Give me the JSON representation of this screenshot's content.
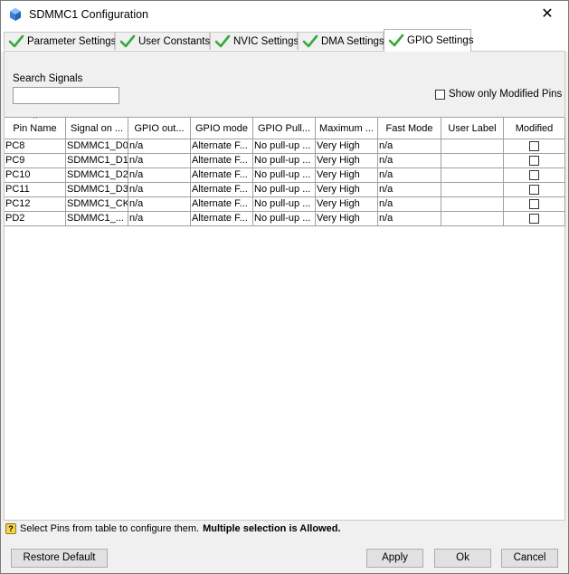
{
  "window": {
    "title": "SDMMC1 Configuration",
    "close_glyph": "✕",
    "icon": "cube-icon"
  },
  "tabs": [
    {
      "label": "Parameter Settings",
      "icon": "check-icon",
      "active": false
    },
    {
      "label": "User Constants",
      "icon": "check-icon",
      "active": false
    },
    {
      "label": "NVIC Settings",
      "icon": "check-icon",
      "active": false
    },
    {
      "label": "DMA Settings",
      "icon": "check-icon",
      "active": false
    },
    {
      "label": "GPIO Settings",
      "icon": "check-icon",
      "active": true
    }
  ],
  "search": {
    "label": "Search Signals",
    "value": "",
    "placeholder": ""
  },
  "show_modified": {
    "label": "Show only Modified Pins",
    "checked": false
  },
  "table": {
    "columns": [
      "Pin Name",
      "Signal on ...",
      "GPIO out...",
      "GPIO mode",
      "GPIO Pull...",
      "Maximum ...",
      "Fast Mode",
      "User Label",
      "Modified"
    ],
    "sort_indicator": "^",
    "rows": [
      {
        "pin": "PC8",
        "signal": "SDMMC1_D0",
        "out": "n/a",
        "mode": "Alternate F...",
        "pull": "No pull-up ...",
        "max": "Very High",
        "fast": "n/a",
        "user": "",
        "modified": false
      },
      {
        "pin": "PC9",
        "signal": "SDMMC1_D1",
        "out": "n/a",
        "mode": "Alternate F...",
        "pull": "No pull-up ...",
        "max": "Very High",
        "fast": "n/a",
        "user": "",
        "modified": false
      },
      {
        "pin": "PC10",
        "signal": "SDMMC1_D2",
        "out": "n/a",
        "mode": "Alternate F...",
        "pull": "No pull-up ...",
        "max": "Very High",
        "fast": "n/a",
        "user": "",
        "modified": false
      },
      {
        "pin": "PC11",
        "signal": "SDMMC1_D3",
        "out": "n/a",
        "mode": "Alternate F...",
        "pull": "No pull-up ...",
        "max": "Very High",
        "fast": "n/a",
        "user": "",
        "modified": false
      },
      {
        "pin": "PC12",
        "signal": "SDMMC1_CK",
        "out": "n/a",
        "mode": "Alternate F...",
        "pull": "No pull-up ...",
        "max": "Very High",
        "fast": "n/a",
        "user": "",
        "modified": false
      },
      {
        "pin": "PD2",
        "signal": "SDMMC1_...",
        "out": "n/a",
        "mode": "Alternate F...",
        "pull": "No pull-up ...",
        "max": "Very High",
        "fast": "n/a",
        "user": "",
        "modified": false
      }
    ]
  },
  "status": {
    "icon": "help-icon",
    "icon_glyph": "?",
    "text": "Select Pins from table to configure them.",
    "bold_text": "Multiple selection is Allowed."
  },
  "buttons": {
    "restore": "Restore Default",
    "apply": "Apply",
    "ok": "Ok",
    "cancel": "Cancel"
  }
}
